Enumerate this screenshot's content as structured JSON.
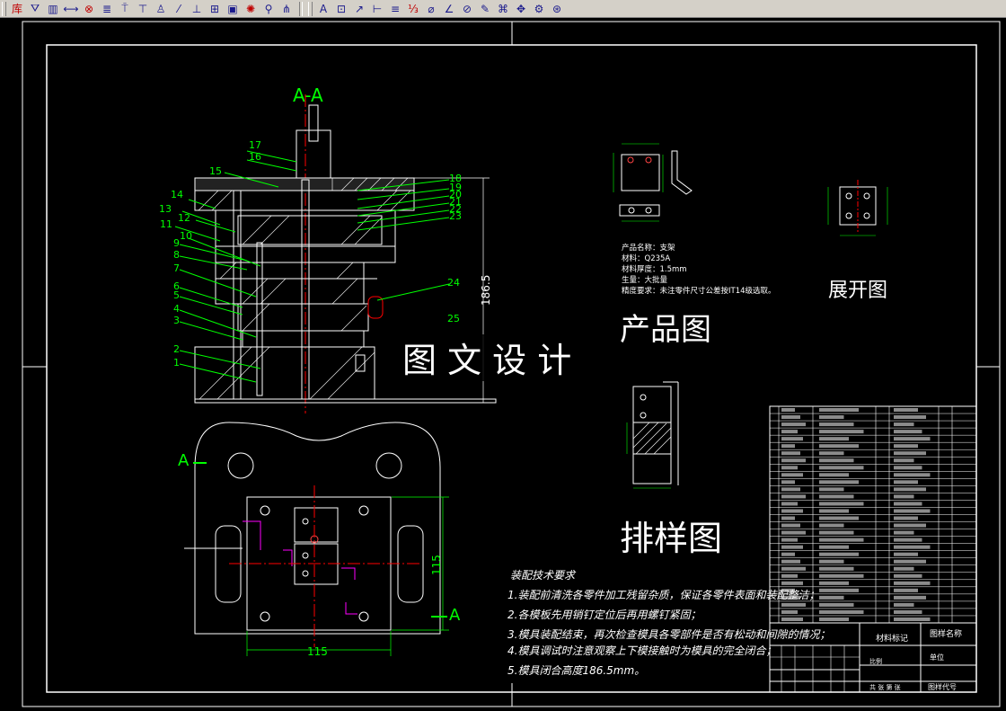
{
  "toolbar": {
    "group1": [
      {
        "glyph": "库",
        "icon": "library-icon",
        "color": "#c00000"
      },
      {
        "glyph": "⛛",
        "icon": "funnel-icon",
        "color": "#1a1a8c"
      },
      {
        "glyph": "▥",
        "icon": "spring-icon",
        "color": "#1a1a8c"
      },
      {
        "glyph": "⟷",
        "icon": "pin-icon",
        "color": "#1a1a8c"
      },
      {
        "glyph": "⊗",
        "icon": "gear-icon",
        "color": "#c00000"
      },
      {
        "glyph": "≣",
        "icon": "thread-icon",
        "color": "#1a1a8c"
      },
      {
        "glyph": "⍑",
        "icon": "screw-icon",
        "color": "#1a1a8c"
      },
      {
        "glyph": "⊤",
        "icon": "bolt-icon",
        "color": "#1a1a8c"
      },
      {
        "glyph": "♙",
        "icon": "rivet-icon",
        "color": "#1a1a8c"
      },
      {
        "glyph": "⁄",
        "icon": "wedge-icon",
        "color": "#1a1a8c"
      },
      {
        "glyph": "⊥",
        "icon": "stud-icon",
        "color": "#1a1a8c"
      },
      {
        "glyph": "⊞",
        "icon": "nut-icon",
        "color": "#1a1a8c"
      },
      {
        "glyph": "▣",
        "icon": "bearing-icon",
        "color": "#1a1a8c"
      },
      {
        "glyph": "✺",
        "icon": "sprocket-icon",
        "color": "#c00000"
      },
      {
        "glyph": "⚲",
        "icon": "key-icon",
        "color": "#1a1a8c"
      },
      {
        "glyph": "⋔",
        "icon": "fork-icon",
        "color": "#1a1a8c"
      }
    ],
    "group2": [
      {
        "glyph": "A",
        "icon": "text-style-icon",
        "color": "#1a1a8c"
      },
      {
        "glyph": "⊡",
        "icon": "frame-icon",
        "color": "#1a1a8c"
      },
      {
        "glyph": "↗",
        "icon": "leader-icon",
        "color": "#1a1a8c"
      },
      {
        "glyph": "⊢",
        "icon": "dimension-icon",
        "color": "#1a1a8c"
      },
      {
        "glyph": "≡",
        "icon": "table-icon",
        "color": "#1a1a8c"
      },
      {
        "glyph": "⅓",
        "icon": "fraction-icon",
        "color": "#c00000"
      },
      {
        "glyph": "⌀",
        "icon": "diameter-icon",
        "color": "#1a1a8c"
      },
      {
        "glyph": "∠",
        "icon": "angle-icon",
        "color": "#1a1a8c"
      },
      {
        "glyph": "⊘",
        "icon": "section-icon",
        "color": "#1a1a8c"
      },
      {
        "glyph": "✎",
        "icon": "edit-icon",
        "color": "#1a1a8c"
      },
      {
        "glyph": "⌘",
        "icon": "weld-icon",
        "color": "#1a1a8c"
      },
      {
        "glyph": "✥",
        "icon": "roughness-icon",
        "color": "#1a1a8c"
      },
      {
        "glyph": "⚙",
        "icon": "settings-icon",
        "color": "#1a1a8c"
      },
      {
        "glyph": "⊛",
        "icon": "balloon-icon",
        "color": "#1a1a8c"
      }
    ]
  },
  "drawing": {
    "section_label": "A-A",
    "height_dim": "186.5",
    "part_numbers": [
      "17",
      "16",
      "15",
      "14",
      "13",
      "12",
      "11",
      "10",
      "9",
      "8",
      "7",
      "6",
      "5",
      "4",
      "3",
      "2",
      "1"
    ],
    "right_numbers": [
      "18",
      "19",
      "20",
      "21",
      "22",
      "23",
      "24",
      "25"
    ],
    "cut_marks": [
      "A",
      "A"
    ],
    "plan_dims": [
      "115",
      "115"
    ],
    "watermark": "图 文 设 计",
    "product": {
      "title": "产品图",
      "spec_lines": [
        "产品名称：支架",
        "材料：Q235A",
        "材料厚度：1.5mm",
        "生量：大批量",
        "精度要求：未注零件尺寸公差按IT14级选取。"
      ]
    },
    "unfold_title": "展开图",
    "layout_title": "排样图",
    "tech_title": "装配技术要求",
    "tech_lines": [
      "1.装配前清洗各零件加工残留杂质，保证各零件表面和装配整洁；",
      "2.各模板先用销钉定位后再用螺钉紧固；",
      "3.模具装配结束，再次检查模具各零部件是否有松动和间隙的情况；",
      "4.模具调试时注意观察上下模接触时为模具的完全闭合；",
      "5.模具闭合高度186.5mm。"
    ],
    "title_block": {
      "material": "材料标记",
      "drawing_name": "图样名称",
      "unit": "单位",
      "drawing_no": "图样代号",
      "scale_label": "比例",
      "sheet": "共 张 第 张"
    }
  }
}
